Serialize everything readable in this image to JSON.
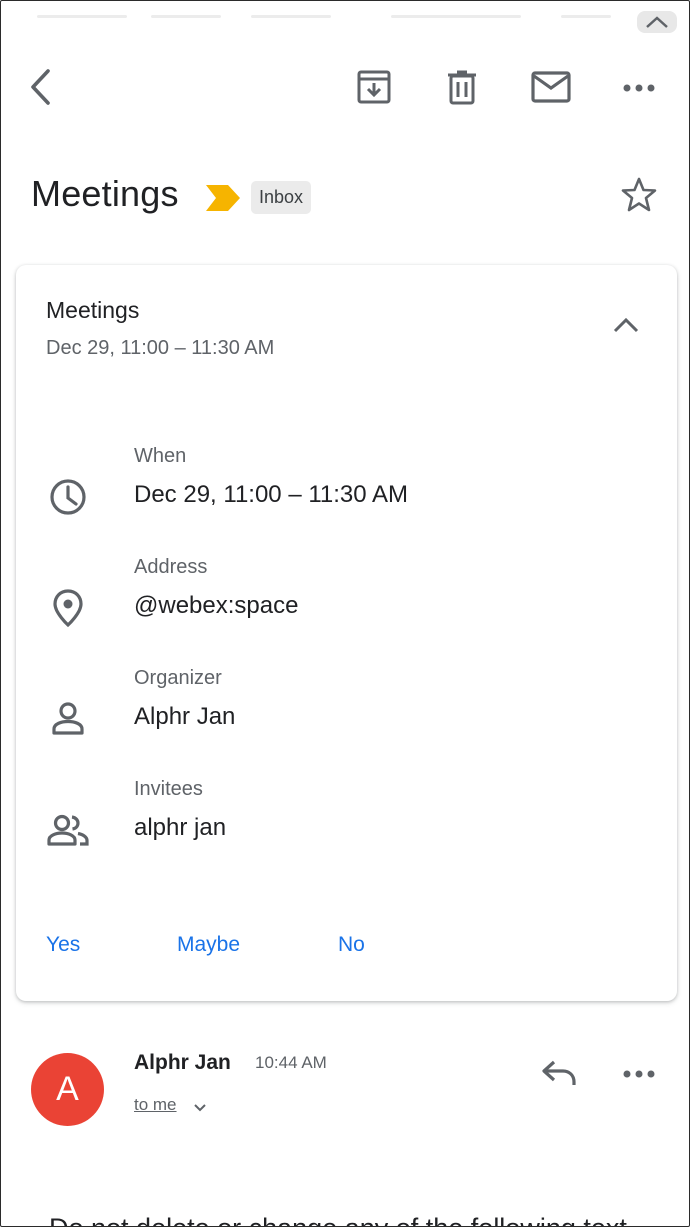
{
  "icons": {
    "back": "arrow-back-icon",
    "archive": "archive-icon",
    "delete": "trash-icon",
    "mark_unread": "mail-icon",
    "more": "more-horizontal-icon",
    "star": "star-outline-icon",
    "collapse": "chevron-up-icon",
    "when": "clock-icon",
    "address": "location-pin-icon",
    "organizer": "person-icon",
    "invitees": "people-icon",
    "reply": "reply-icon",
    "message_more": "more-horizontal-icon",
    "recipient_expand": "chevron-down-icon"
  },
  "colors": {
    "accent": "#1a73e8",
    "importance": "#f6b400",
    "avatar": "#ea4335",
    "icon": "#5f6368"
  },
  "thread": {
    "subject": "Meetings",
    "label": "Inbox"
  },
  "event": {
    "title": "Meetings",
    "subtitle": "Dec 29, 11:00 – 11:30 AM",
    "details": [
      {
        "label": "When",
        "value": "Dec 29, 11:00 – 11:30 AM"
      },
      {
        "label": "Address",
        "value": "@webex:space"
      },
      {
        "label": "Organizer",
        "value": "Alphr Jan"
      },
      {
        "label": "Invitees",
        "value": "alphr jan"
      }
    ],
    "rsvp": {
      "yes": "Yes",
      "maybe": "Maybe",
      "no": "No"
    }
  },
  "message": {
    "avatar_letter": "A",
    "sender": "Alphr Jan",
    "time": "10:44 AM",
    "recipient": "to me",
    "body_preview": "Do not delete or change any of the following text"
  }
}
